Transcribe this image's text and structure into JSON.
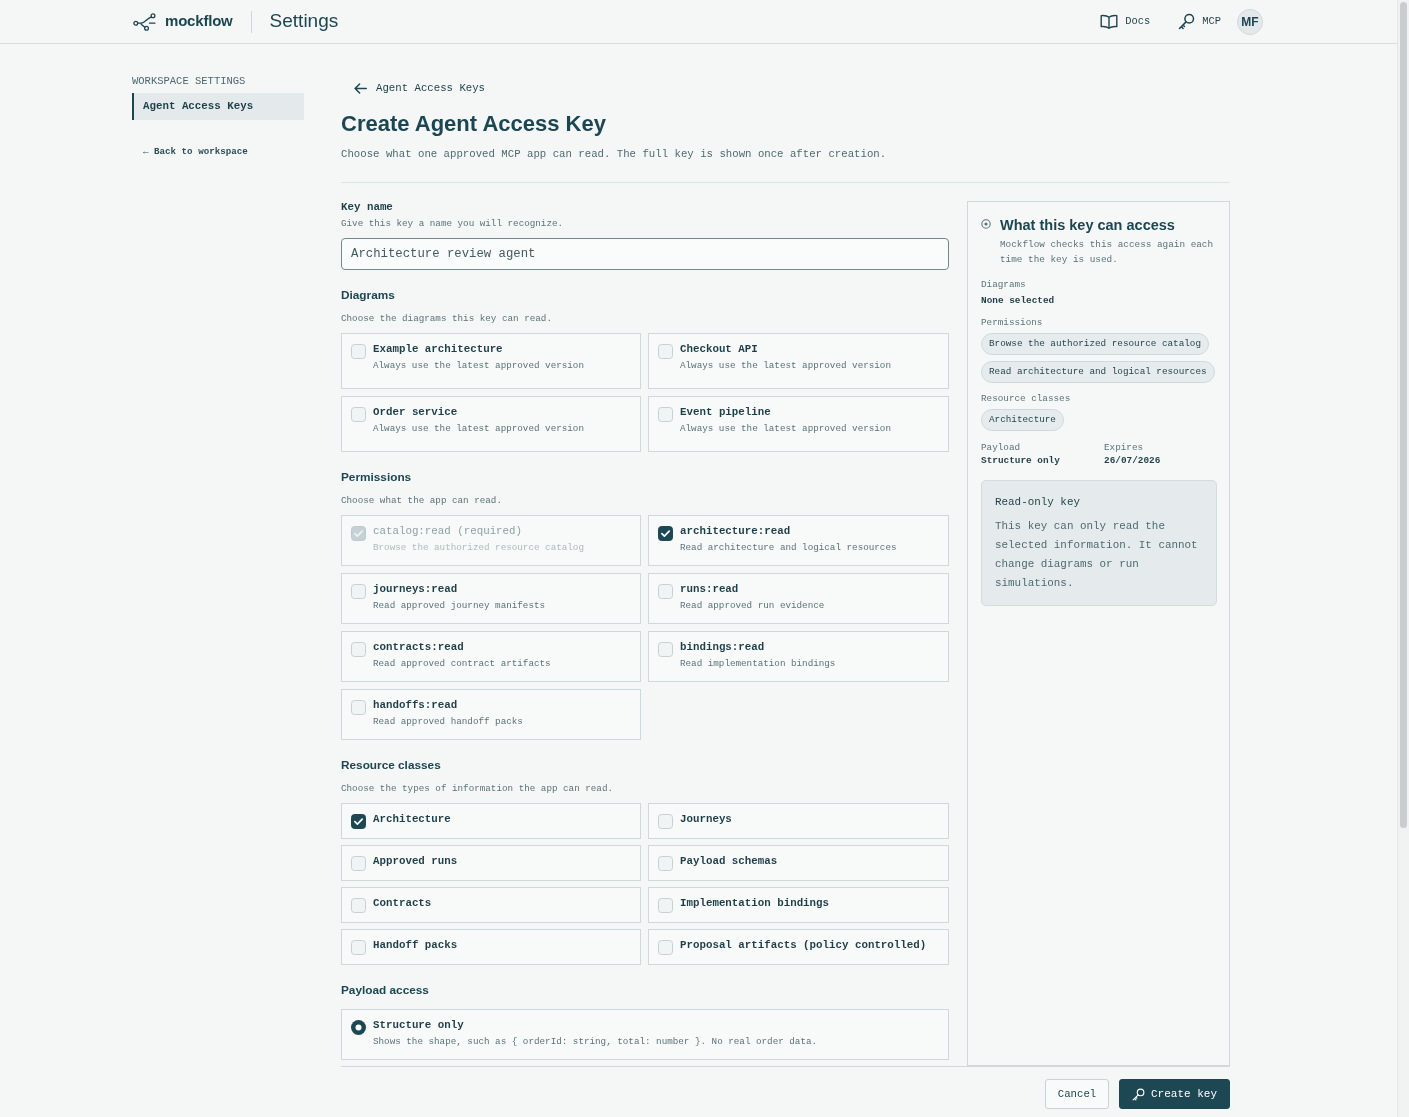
{
  "header": {
    "brand": "mockflow",
    "title": "Settings",
    "links": [
      {
        "kind": "docs",
        "label": "Docs"
      },
      {
        "kind": "mcp",
        "label": "MCP"
      }
    ],
    "avatar": "MF"
  },
  "sidebar": {
    "heading": "WORKSPACE SETTINGS",
    "items": [
      {
        "label": "Agent Access Keys",
        "selected": true
      }
    ],
    "back_link": "← Back to workspace"
  },
  "breadcrumb": {
    "label": "Agent Access Keys"
  },
  "page": {
    "title": "Create Agent Access Key",
    "subtitle": "Choose what one approved MCP app can read. The full key is shown once after creation."
  },
  "key_name": {
    "label": "Key name",
    "help": "Give this key a name you will recognize.",
    "placeholder": "Architecture review agent"
  },
  "diagrams": {
    "title": "Diagrams",
    "help": "Choose the diagrams this key can read.",
    "items": [
      {
        "name": "Example architecture",
        "note": "Always use the latest approved version",
        "checked": false
      },
      {
        "name": "Checkout API",
        "note": "Always use the latest approved version",
        "checked": false
      },
      {
        "name": "Order service",
        "note": "Always use the latest approved version",
        "checked": false
      },
      {
        "name": "Event pipeline",
        "note": "Always use the latest approved version",
        "checked": false
      }
    ]
  },
  "permissions": {
    "title": "Permissions",
    "help": "Choose what the app can read.",
    "items": [
      {
        "scope": "catalog:read (required)",
        "description": "Browse the authorized resource catalog",
        "checked": true,
        "disabled": true
      },
      {
        "scope": "architecture:read",
        "description": "Read architecture and logical resources",
        "checked": true,
        "disabled": false
      },
      {
        "scope": "journeys:read",
        "description": "Read approved journey manifests",
        "checked": false,
        "disabled": false
      },
      {
        "scope": "runs:read",
        "description": "Read approved run evidence",
        "checked": false,
        "disabled": false
      },
      {
        "scope": "contracts:read",
        "description": "Read approved contract artifacts",
        "checked": false,
        "disabled": false
      },
      {
        "scope": "bindings:read",
        "description": "Read implementation bindings",
        "checked": false,
        "disabled": false
      },
      {
        "scope": "handoffs:read",
        "description": "Read approved handoff packs",
        "checked": false,
        "disabled": false
      }
    ]
  },
  "resource_classes": {
    "title": "Resource classes",
    "help": "Choose the types of information the app can read.",
    "items": [
      {
        "label": "Architecture",
        "checked": true
      },
      {
        "label": "Journeys",
        "checked": false
      },
      {
        "label": "Approved runs",
        "checked": false
      },
      {
        "label": "Payload schemas",
        "checked": false
      },
      {
        "label": "Contracts",
        "checked": false
      },
      {
        "label": "Implementation bindings",
        "checked": false
      },
      {
        "label": "Handoff packs",
        "checked": false
      },
      {
        "label": "Proposal artifacts (policy controlled)",
        "checked": false
      }
    ]
  },
  "payload_access": {
    "title": "Payload access",
    "options": [
      {
        "label": "Structure only",
        "description": "Shows the shape, such as { orderId: string, total: number }. No real order data.",
        "selected": true
      }
    ]
  },
  "summary": {
    "title": "What this key can access",
    "note": "Mockflow checks this access again each time the key is used.",
    "sections": [
      {
        "kind": "text",
        "label": "Diagrams",
        "value": "None selected"
      },
      {
        "kind": "chips",
        "label": "Permissions",
        "chips": [
          "Browse the authorized resource catalog",
          "Read architecture and logical resources"
        ]
      },
      {
        "kind": "chips",
        "label": "Resource classes",
        "chips": [
          "Architecture"
        ]
      }
    ],
    "details": [
      {
        "label": "Payload",
        "value": "Structure only"
      },
      {
        "label": "Expires",
        "value": "26/07/2026"
      }
    ],
    "notice": {
      "title": "Read-only key",
      "body": "This key can only read the selected information. It cannot change diagrams or run simulations."
    }
  },
  "footer": {
    "buttons": [
      {
        "kind": "cancel",
        "label": "Cancel"
      },
      {
        "kind": "submit",
        "label": "Create key"
      }
    ]
  }
}
